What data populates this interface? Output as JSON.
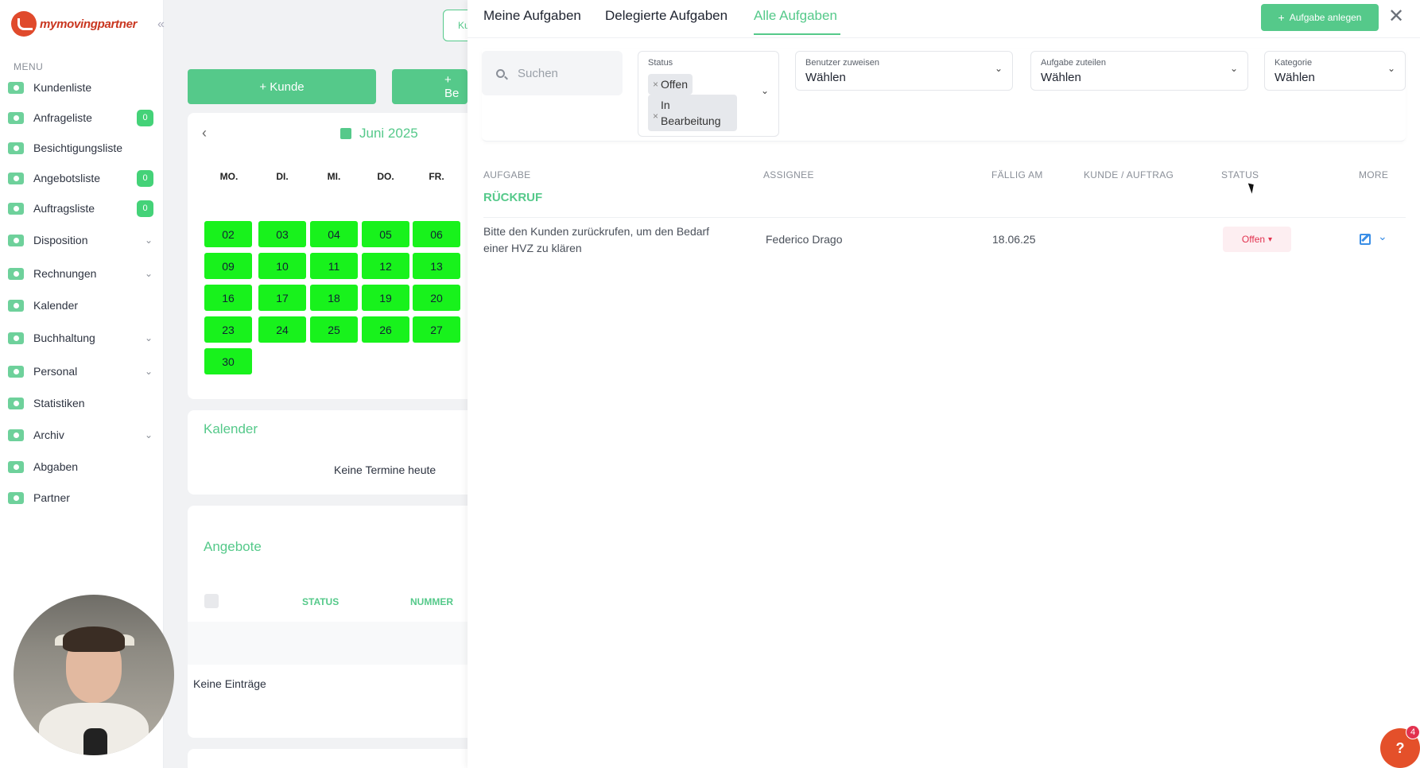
{
  "app": {
    "logo_text": "mymovingpartner",
    "collapse_glyph": "«"
  },
  "sidebar": {
    "menu_label": "MENU",
    "items": [
      {
        "label": "Kundenliste",
        "icon": "customers-icon"
      },
      {
        "label": "Anfrageliste",
        "icon": "inbox-icon",
        "badge": "0"
      },
      {
        "label": "Besichtigungsliste",
        "icon": "house-icon"
      },
      {
        "label": "Angebotsliste",
        "icon": "document-icon",
        "badge": "0"
      },
      {
        "label": "Auftragsliste",
        "icon": "clipboard-icon",
        "badge": "0"
      },
      {
        "label": "Disposition",
        "icon": "dispatch-icon",
        "expandable": true
      },
      {
        "label": "Rechnungen",
        "icon": "invoice-icon",
        "expandable": true
      },
      {
        "label": "Kalender",
        "icon": "calendar-icon"
      },
      {
        "label": "Buchhaltung",
        "icon": "accounting-icon",
        "expandable": true
      },
      {
        "label": "Personal",
        "icon": "staff-icon",
        "expandable": true
      },
      {
        "label": "Statistiken",
        "icon": "stats-icon"
      },
      {
        "label": "Archiv",
        "icon": "archive-icon",
        "expandable": true
      },
      {
        "label": "Abgaben",
        "icon": "network-icon"
      },
      {
        "label": "Partner",
        "icon": "handshake-icon"
      }
    ]
  },
  "dashboard": {
    "btn_customer": "+ Kunde",
    "btn_second": "+ Be",
    "top_stub": "Ku",
    "calendar": {
      "month": "Juni 2025",
      "weekdays": [
        "MO.",
        "DI.",
        "MI.",
        "DO.",
        "FR."
      ],
      "days": [
        "02",
        "03",
        "04",
        "05",
        "06",
        "09",
        "10",
        "11",
        "12",
        "13",
        "16",
        "17",
        "18",
        "19",
        "20",
        "23",
        "24",
        "25",
        "26",
        "27",
        "30"
      ]
    },
    "kalender_title": "Kalender",
    "no_appointments": "Keine Termine heute",
    "angebote_title": "Angebote",
    "angebote_cols": [
      "STATUS",
      "NUMMER"
    ],
    "no_entries": "Keine Einträge"
  },
  "panel": {
    "tabs": [
      "Meine Aufgaben",
      "Delegierte Aufgaben",
      "Alle Aufgaben"
    ],
    "active_tab": "Alle Aufgaben",
    "new_task_label": "Aufgabe anlegen",
    "close_glyph": "✕",
    "search_placeholder": "Suchen",
    "filters": {
      "status_label": "Status",
      "status_chips": [
        "Offen",
        "In Bearbeitung"
      ],
      "assign_user_label": "Benutzer zuweisen",
      "assign_user_value": "Wählen",
      "allocate_label": "Aufgabe zuteilen",
      "allocate_value": "Wählen",
      "category_label": "Kategorie",
      "category_value": "Wählen"
    },
    "columns": [
      "AUFGABE",
      "ASSIGNEE",
      "FÄLLIG AM",
      "KUNDE / AUFTRAG",
      "STATUS",
      "MORE"
    ],
    "group": "RÜCKRUF",
    "rows": [
      {
        "task": "Bitte den Kunden zurückrufen, um den Bedarf einer HVZ zu klären",
        "assignee": "Federico Drago",
        "due": "18.06.25",
        "customer_order": "",
        "status": "Offen"
      }
    ]
  },
  "help": {
    "glyph": "?",
    "badge": "4"
  },
  "colors": {
    "accent": "#55c98a",
    "calendar_day": "#18f21c",
    "status_open": "#e2324f",
    "help": "#e4502a"
  }
}
